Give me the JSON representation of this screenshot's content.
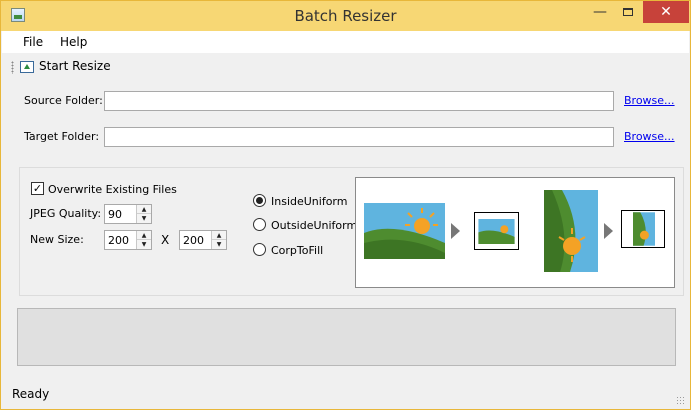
{
  "window": {
    "title": "Batch Resizer",
    "minimize_glyph": "—",
    "close_glyph": "✕"
  },
  "menu": {
    "file": "File",
    "help": "Help"
  },
  "toolbar": {
    "start_resize_label": "Start Resize",
    "start_resize_icon": "resize-icon"
  },
  "source": {
    "label": "Source Folder:",
    "value": "",
    "browse": "Browse..."
  },
  "target": {
    "label": "Target Folder:",
    "value": "",
    "browse": "Browse..."
  },
  "options": {
    "overwrite_label": "Overwrite Existing Files",
    "overwrite_checked": true,
    "check_glyph": "✓",
    "jpeg_quality_label": "JPEG Quality:",
    "jpeg_quality": "90",
    "new_size_label": "New Size:",
    "width": "200",
    "height": "200",
    "size_separator": "X",
    "spin_up": "▲",
    "spin_down": "▼",
    "modes": [
      {
        "label": "InsideUniform",
        "checked": true
      },
      {
        "label": "OutsideUniform",
        "checked": false
      },
      {
        "label": "CorpToFill",
        "checked": false
      }
    ]
  },
  "colors": {
    "titlebar": "#f7d774",
    "close_button": "#c7423a",
    "sky": "#5fb4df",
    "hill": "#4e8c2f",
    "sun": "#f4a225",
    "link": "#0000ee"
  },
  "status": {
    "text": "Ready"
  }
}
